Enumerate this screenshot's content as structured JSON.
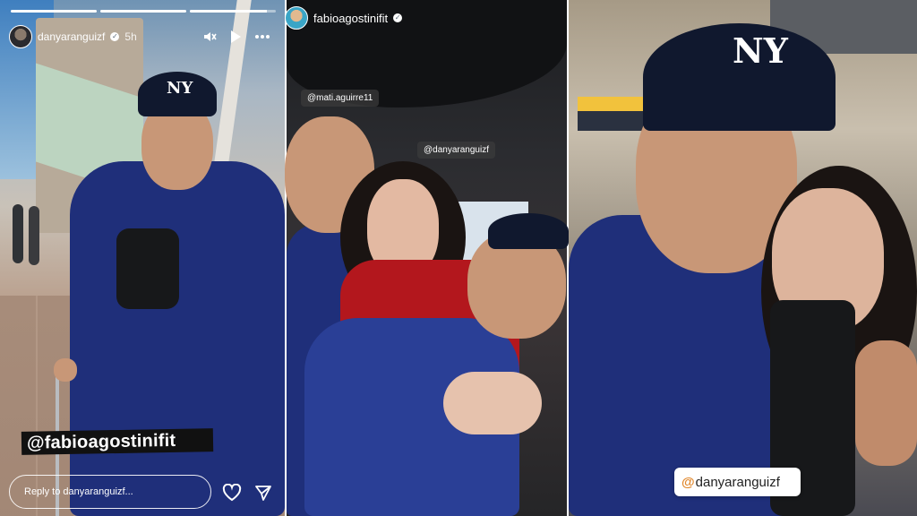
{
  "story1": {
    "username": "danyaranguizf",
    "time": "5h",
    "progress_segments": [
      1,
      1,
      0.9
    ],
    "mention_sticker": "@fabioagostinifit",
    "reply_placeholder": "Reply to danyaranguizf..."
  },
  "story2": {
    "username": "fabioagostinifit",
    "tags": [
      "@mati.aguirre11",
      "@danyaranguizf"
    ]
  },
  "story3": {
    "mention_at": "@",
    "mention_name": "danyaranguizf"
  },
  "logos": {
    "cap": "NY"
  },
  "icons": [
    "verified-badge-icon",
    "mute-icon",
    "play-icon",
    "more-icon",
    "heart-icon",
    "send-icon"
  ],
  "colors": {
    "hoodie": "#1f2f7a",
    "sticker_dark": "#111111",
    "sticker_accent": "#e0872b"
  }
}
